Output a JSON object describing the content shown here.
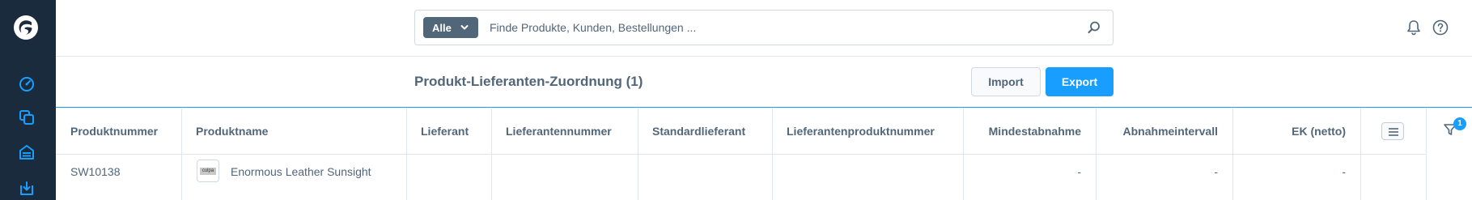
{
  "header": {
    "search": {
      "type_label": "Alle",
      "placeholder": "Finde Produkte, Kunden, Bestellungen ..."
    }
  },
  "smartbar": {
    "title": "Produkt-Lieferanten-Zuordnung (1)",
    "import_label": "Import",
    "export_label": "Export"
  },
  "table": {
    "columns": [
      "Produktnummer",
      "Produktname",
      "Lieferant",
      "Lieferantennummer",
      "Standardlieferant",
      "Lieferantenproduktnummer",
      "Mindestabnahme",
      "Abnahmeintervall",
      "EK (netto)"
    ],
    "rows": [
      {
        "produktnummer": "SW10138",
        "thumb_text": "culpa",
        "produktname": "Enormous Leather Sunsight",
        "lieferant": "",
        "lieferantennummer": "",
        "standardlieferant": "",
        "lieferantenproduktnummer": "",
        "mindestabnahme": "-",
        "abnahmeintervall": "-",
        "ek_netto": "-"
      }
    ]
  },
  "filter": {
    "badge_count": "1"
  },
  "colors": {
    "sidebar_bg": "#1b2b3e",
    "accent": "#189eff",
    "text": "#52667a",
    "icon_accent": "#189eff"
  },
  "icons": {
    "logo": "shopware-logo",
    "sidebar": [
      "dashboard-icon",
      "catalog-icon",
      "orders-icon",
      "customers-icon"
    ],
    "search": "search-icon",
    "notifications": "bell-icon",
    "help": "help-icon",
    "column_settings": "list-icon",
    "filter": "filter-icon"
  }
}
